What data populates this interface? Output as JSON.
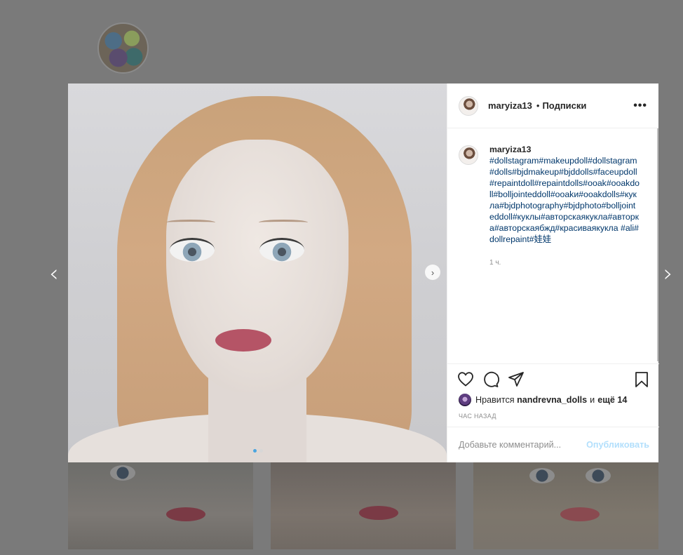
{
  "header": {
    "username": "maryiza13",
    "separator": "•",
    "follow_label": "Подписки",
    "more_label": "•••"
  },
  "caption": {
    "username": "maryiza13",
    "tags": "#dollstagram#makeupdoll#dollstagram#dolls#bjdmakeup#bjddolls#faceupdoll#repaintdoll#repaintdolls#ooak#ooakdoll#bolljointeddoll#ooakи#ooakdolls#кукла#bjdphotography#bjdphoto#bolljointeddoll#куклы#авторскаякукла#авторка#авторскаябжд#красиваякукла #ali#dollrepaint#娃娃",
    "time": "1 ч."
  },
  "likes": {
    "prefix": "Нравится",
    "user": "nandrevna_dolls",
    "conjunction": "и",
    "more": "ещё 14"
  },
  "post_time": "ЧАС НАЗАД",
  "comment": {
    "placeholder": "Добавьте комментарий...",
    "submit_label": "Опубликовать"
  },
  "navigation": {
    "prev_glyph": "‹",
    "next_glyph": "›",
    "inner_next_glyph": "›"
  },
  "carousel": {
    "count": 2,
    "active_index": 0
  },
  "icons": {
    "like": "heart-icon",
    "comment": "comment-icon",
    "share": "paper-plane-icon",
    "save": "bookmark-icon"
  },
  "colors": {
    "link": "#00376b",
    "muted": "#8e8e8e",
    "post_button_disabled": "#b2dffc",
    "carousel_active": "#4aa5e0"
  }
}
